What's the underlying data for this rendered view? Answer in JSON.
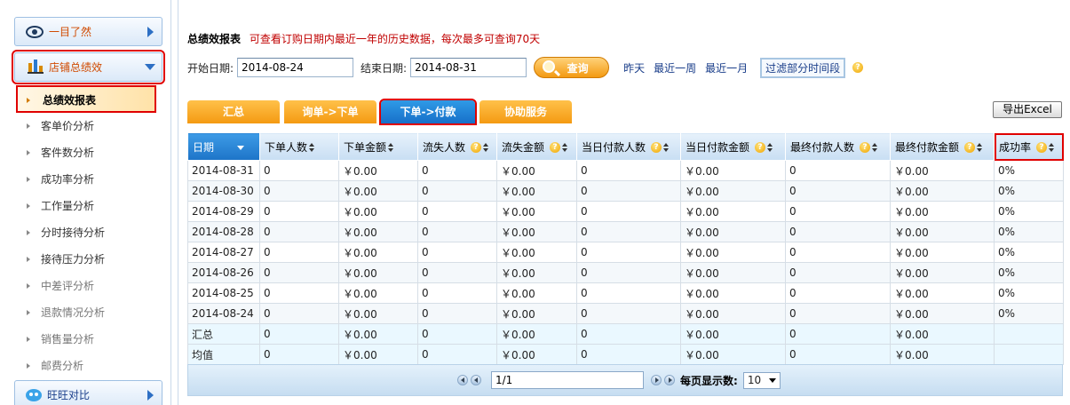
{
  "sidebar": {
    "top_item": {
      "label": "一目了然",
      "icon": "eye-icon"
    },
    "section": {
      "label": "店铺总绩效",
      "icon": "bar-chart-icon"
    },
    "items": [
      {
        "label": "总绩效报表",
        "active": true
      },
      {
        "label": "客单价分析"
      },
      {
        "label": "客件数分析"
      },
      {
        "label": "成功率分析"
      },
      {
        "label": "工作量分析"
      },
      {
        "label": "分时接待分析"
      },
      {
        "label": "接待压力分析"
      },
      {
        "label": "中差评分析"
      },
      {
        "label": "退款情况分析"
      },
      {
        "label": "销售量分析"
      },
      {
        "label": "邮费分析"
      }
    ],
    "bottom_item": {
      "label": "旺旺对比",
      "icon": "wangwang-icon"
    }
  },
  "header": {
    "title": "总绩效报表",
    "note": "可查看订购日期内最近一年的历史数据，每次最多可查询70天"
  },
  "filter": {
    "start_label": "开始日期:",
    "start_value": "2014-08-24",
    "end_label": "结束日期:",
    "end_value": "2014-08-31",
    "query_label": "查询",
    "quick_links": [
      "昨天",
      "最近一周",
      "最近一月"
    ],
    "partial_filter_label": "过滤部分时间段"
  },
  "tabs": [
    {
      "label": "汇总"
    },
    {
      "label": "询单->下单"
    },
    {
      "label": "下单->付款",
      "active": true
    },
    {
      "label": "协助服务"
    }
  ],
  "export_label": "导出Excel",
  "table": {
    "columns": [
      "日期",
      "下单人数",
      "下单金额",
      "流失人数",
      "流失金额",
      "当日付款人数",
      "当日付款金额",
      "最终付款人数",
      "最终付款金额",
      "成功率"
    ],
    "rows": [
      [
        "2014-08-31",
        "0",
        "￥0.00",
        "0",
        "￥0.00",
        "0",
        "￥0.00",
        "0",
        "￥0.00",
        "0%"
      ],
      [
        "2014-08-30",
        "0",
        "￥0.00",
        "0",
        "￥0.00",
        "0",
        "￥0.00",
        "0",
        "￥0.00",
        "0%"
      ],
      [
        "2014-08-29",
        "0",
        "￥0.00",
        "0",
        "￥0.00",
        "0",
        "￥0.00",
        "0",
        "￥0.00",
        "0%"
      ],
      [
        "2014-08-28",
        "0",
        "￥0.00",
        "0",
        "￥0.00",
        "0",
        "￥0.00",
        "0",
        "￥0.00",
        "0%"
      ],
      [
        "2014-08-27",
        "0",
        "￥0.00",
        "0",
        "￥0.00",
        "0",
        "￥0.00",
        "0",
        "￥0.00",
        "0%"
      ],
      [
        "2014-08-26",
        "0",
        "￥0.00",
        "0",
        "￥0.00",
        "0",
        "￥0.00",
        "0",
        "￥0.00",
        "0%"
      ],
      [
        "2014-08-25",
        "0",
        "￥0.00",
        "0",
        "￥0.00",
        "0",
        "￥0.00",
        "0",
        "￥0.00",
        "0%"
      ],
      [
        "2014-08-24",
        "0",
        "￥0.00",
        "0",
        "￥0.00",
        "0",
        "￥0.00",
        "0",
        "￥0.00",
        "0%"
      ]
    ],
    "summary_rows": [
      [
        "汇总",
        "0",
        "￥0.00",
        "0",
        "￥0.00",
        "0",
        "￥0.00",
        "0",
        "￥0.00",
        ""
      ],
      [
        "均值",
        "0",
        "￥0.00",
        "0",
        "￥0.00",
        "0",
        "￥0.00",
        "0",
        "￥0.00",
        ""
      ]
    ]
  },
  "pager": {
    "page_value": "1/1",
    "pagesize_label": "每页显示数:",
    "pagesize_value": "10"
  },
  "colors": {
    "accent_orange": "#f49a12",
    "active_blue": "#1d74c8",
    "highlight_red": "#e00000",
    "note_red": "#c00000",
    "link_blue": "#1a3e8a"
  }
}
